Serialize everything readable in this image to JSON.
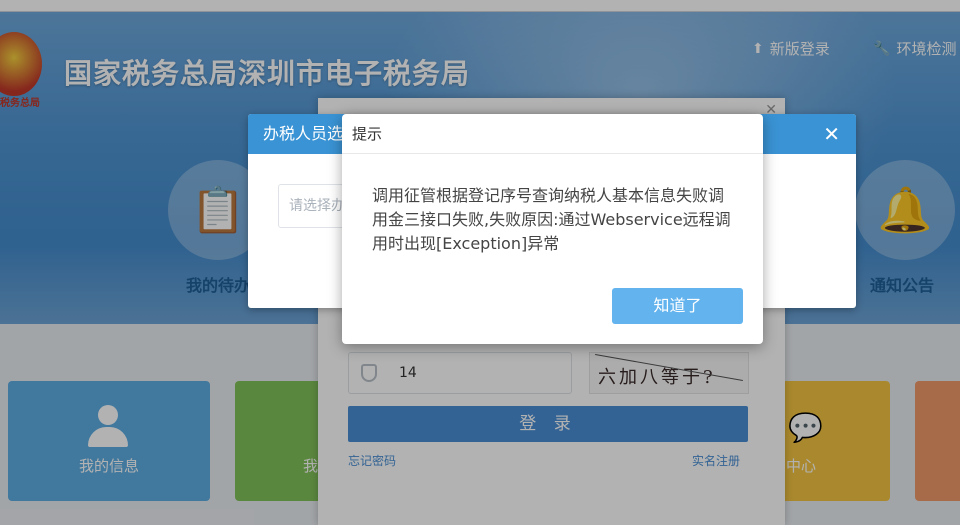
{
  "header": {
    "emblem_text": "税务总局",
    "title": "国家税务总局深圳市电子税务局",
    "new_login": "新版登录",
    "env_check": "环境检测",
    "new_login_icon": "upload-arrow-icon",
    "env_check_icon": "wrench-icon"
  },
  "shortcuts": {
    "todo_label": "我的待办",
    "notice_label": "通知公告"
  },
  "tiles": {
    "info_label": "我的信息",
    "green_label": "我",
    "yellow_label": "中心"
  },
  "login": {
    "captcha_value": "14",
    "captcha_text": "六加八等于?",
    "login_button": "登 录",
    "forgot": "忘记密码",
    "register": "实名注册"
  },
  "agent_dialog": {
    "title": "办税人员选",
    "select_placeholder": "请选择办"
  },
  "alert": {
    "title": "提示",
    "message": "调用征管根据登记序号查询纳税人基本信息失败调用金三接口失败,失败原因:通过Webservice远程调用时出现[Exception]异常",
    "ok_button": "知道了"
  },
  "colors": {
    "brand_blue": "#3a93d4",
    "ok_button": "#62b3ee",
    "tile_info": "#5dade2",
    "tile_green": "#82c25a",
    "tile_yellow": "#f4c542"
  }
}
